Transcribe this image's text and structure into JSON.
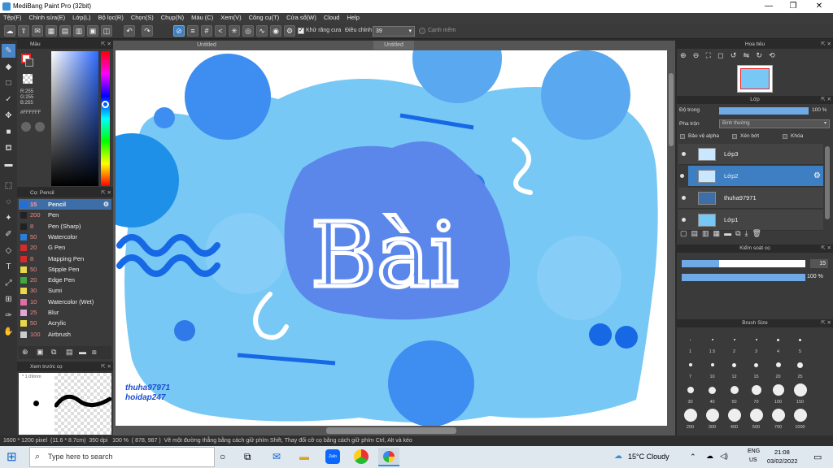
{
  "window": {
    "title": "MediBang Paint Pro (32bit)",
    "controls": [
      "—",
      "❐",
      "✕"
    ]
  },
  "menu": [
    "Tệp(F)",
    "Chỉnh sửa(E)",
    "Lớp(L)",
    "Bộ lọc(R)",
    "Chọn(S)",
    "Chụp(N)",
    "Màu (C)",
    "Xem(V)",
    "Công cụ(T)",
    "Cửa sổ(W)",
    "Cloud",
    "Help"
  ],
  "toolbar": {
    "antialias_label": "Khử răng cưa",
    "adjust_label": "Điều chỉnh",
    "adjust_value": "39",
    "smooth_label": "Cạnh mềm"
  },
  "color_panel": {
    "title": "Màu",
    "r": "R:255",
    "g": "G:255",
    "b": "B:255",
    "hex": "#FFFFFF"
  },
  "brush_panel": {
    "title": "Cọ: Pencil",
    "items": [
      {
        "size": "15",
        "name": "Pencil",
        "color": "#1e6fd9"
      },
      {
        "size": "200",
        "name": "Pen",
        "color": "#222222"
      },
      {
        "size": "8",
        "name": "Pen (Sharp)",
        "color": "#222222"
      },
      {
        "size": "50",
        "name": "Watercolor",
        "color": "#2c7fd8"
      },
      {
        "size": "20",
        "name": "G Pen",
        "color": "#d62b2b"
      },
      {
        "size": "8",
        "name": "Mapping Pen",
        "color": "#d62b2b"
      },
      {
        "size": "50",
        "name": "Stipple Pen",
        "color": "#e8d84a"
      },
      {
        "size": "20",
        "name": "Edge Pen",
        "color": "#3cab3c"
      },
      {
        "size": "30",
        "name": "Sumi",
        "color": "#e8d84a"
      },
      {
        "size": "10",
        "name": "Watercolor (Wet)",
        "color": "#e06fa8"
      },
      {
        "size": "25",
        "name": "Blur",
        "color": "#e6a6d6"
      },
      {
        "size": "50",
        "name": "Acrylic",
        "color": "#e8d84a"
      },
      {
        "size": "100",
        "name": "Airbrush",
        "color": "#cccccc"
      }
    ]
  },
  "preview_panel": {
    "title": "Xem trước cọ",
    "size": "1.09mm"
  },
  "tabs": [
    "Untitled",
    "Untitled"
  ],
  "canvas": {
    "main_text": "Bài",
    "watermark_1": "thuha97971",
    "watermark_2": "hoidap247"
  },
  "navigator": {
    "title": "Hoa tiêu"
  },
  "layer_panel": {
    "title": "Lớp",
    "opacity_label": "Độ trong",
    "opacity_value": "100 %",
    "blend_label": "Pha trộn",
    "blend_value": "Bình thường",
    "protect_alpha": "Bảo vệ alpha",
    "clipping": "Xén bớt",
    "lock": "Khóa",
    "layers": [
      "Lớp3",
      "Lớp2",
      "thuha97971",
      "Lớp1"
    ]
  },
  "brush_control": {
    "title": "Kiểm soát cọ",
    "size": "15",
    "opacity": "100 %"
  },
  "brush_size": {
    "title": "Brush Size",
    "sizes": [
      "1",
      "1.5",
      "2",
      "3",
      "4",
      "5",
      "7",
      "10",
      "12",
      "15",
      "20",
      "25",
      "30",
      "40",
      "50",
      "70",
      "100",
      "150",
      "200",
      "300",
      "400",
      "500",
      "700",
      "1000"
    ]
  },
  "status": {
    "dimensions": "1600 * 1200 pixel",
    "physical": "(11.6 * 8.7cm)",
    "dpi": "350 dpi",
    "zoom": "100 %",
    "coords": "( 878, 987 )",
    "hint": "Vẽ một đường thẳng bằng cách giữ phím Shift, Thay đổi cỡ cọ bằng cách giữ phím Ctrl, Alt và kéo"
  },
  "taskbar": {
    "search_placeholder": "Type here to search",
    "weather": "15°C  Cloudy",
    "lang": "ENG",
    "region": "US",
    "time": "21:08",
    "date": "03/02/2022"
  }
}
